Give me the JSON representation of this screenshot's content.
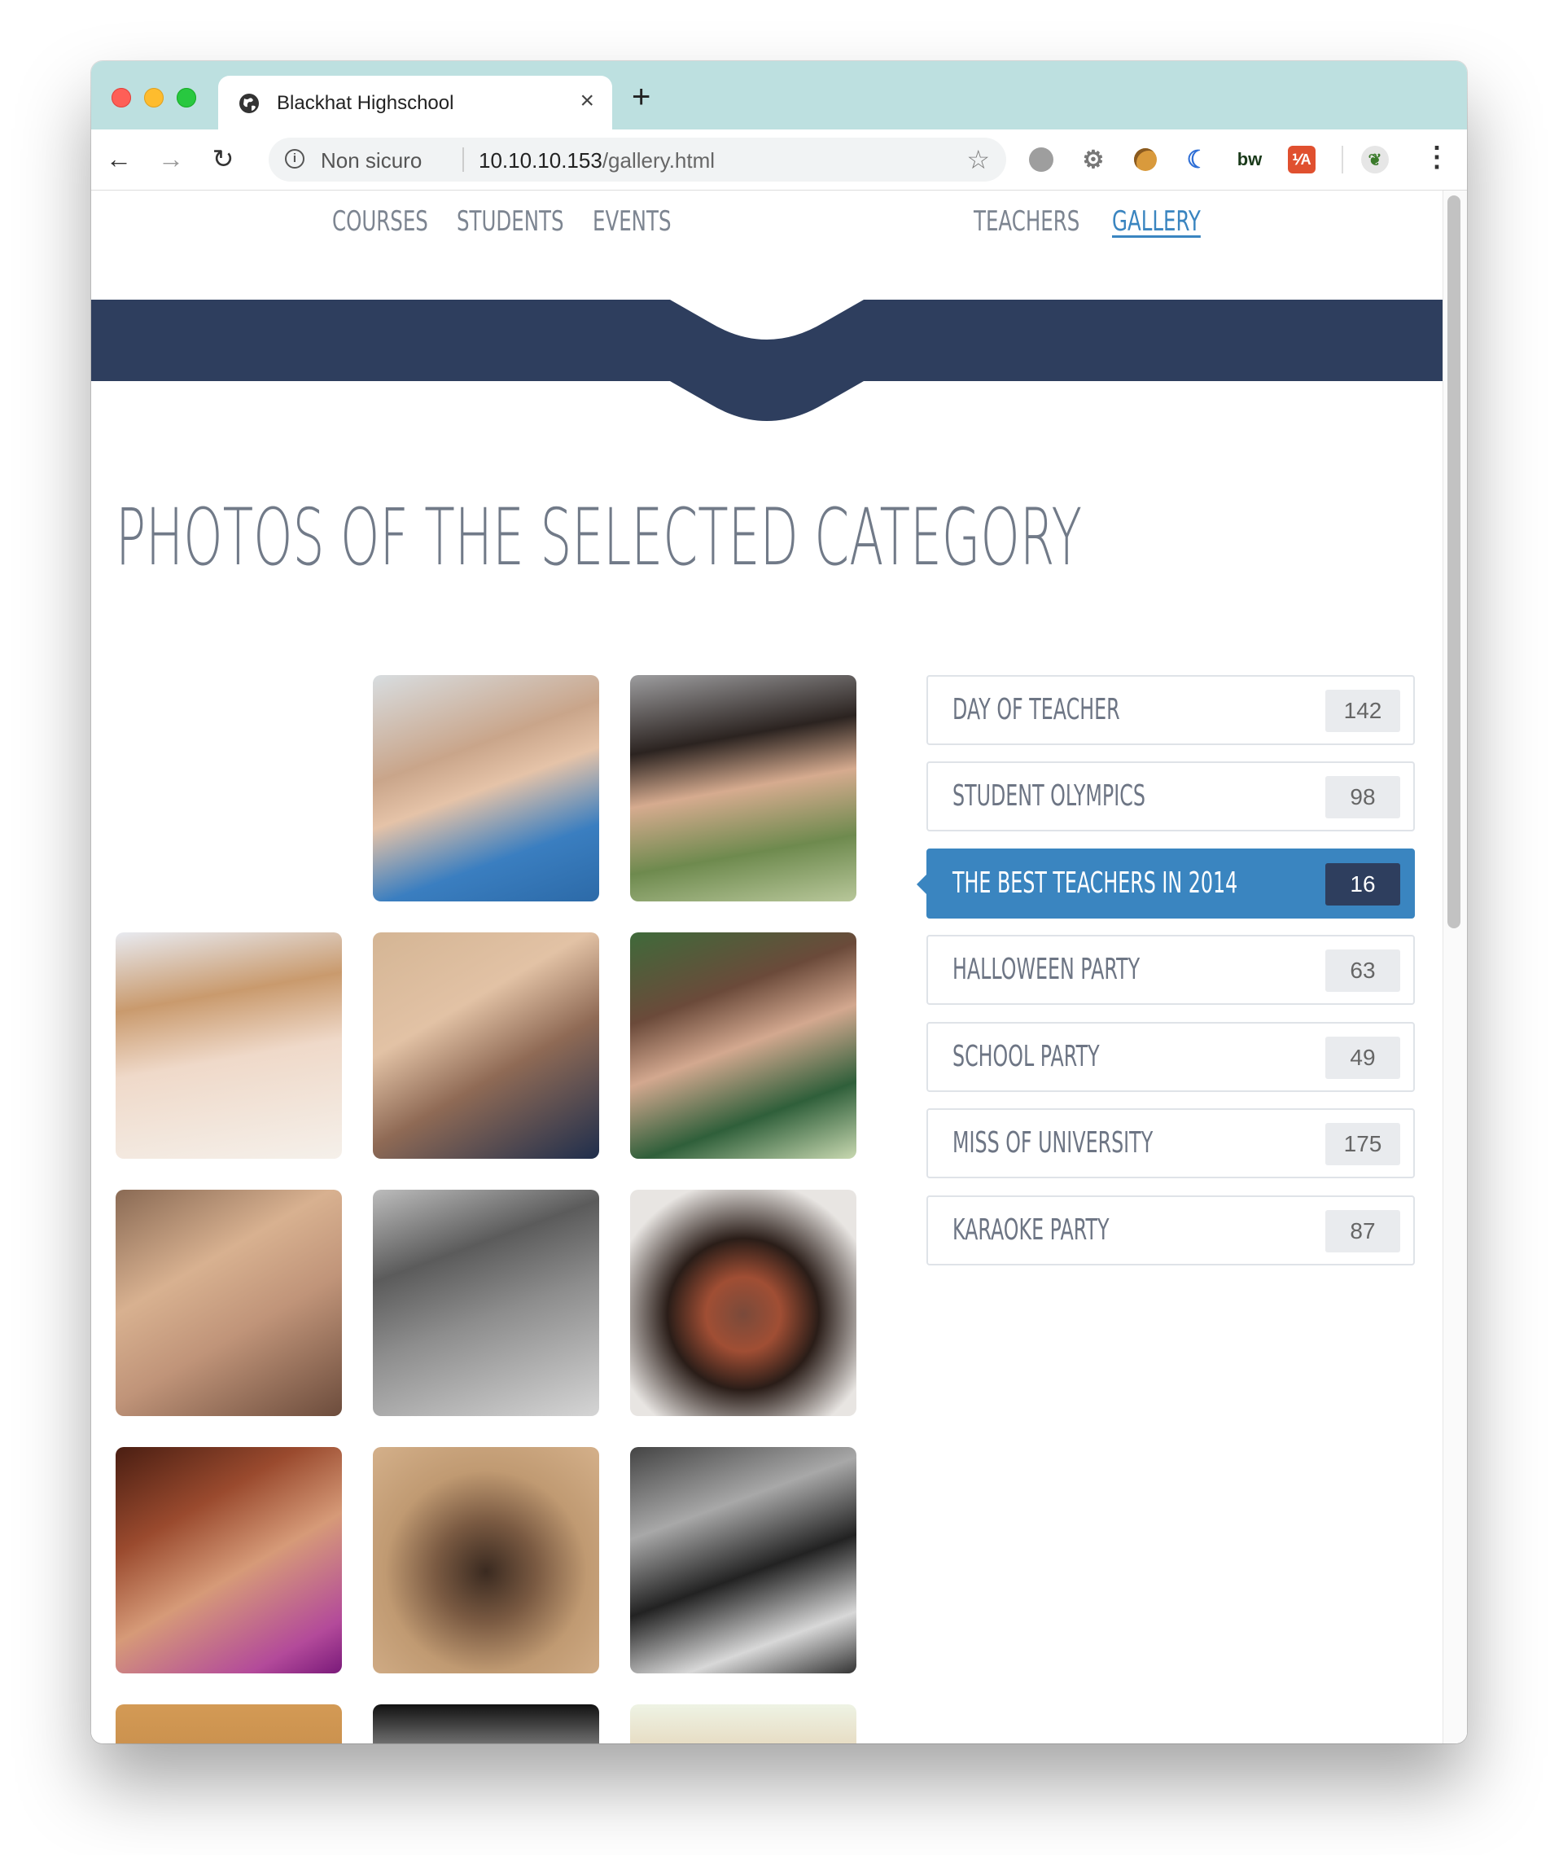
{
  "browser": {
    "tab_title": "Blackhat Highschool",
    "new_tab_label": "+",
    "close_label": "×",
    "address": {
      "security_label": "Non sicuro",
      "host": "10.10.10.153",
      "path": "/gallery.html"
    }
  },
  "site": {
    "nav": {
      "courses": "COURSES",
      "students": "STUDENTS",
      "events": "EVENTS",
      "teachers": "TEACHERS",
      "gallery": "GALLERY"
    },
    "banner_color": "#2e3e5e",
    "page_title": "PHOTOS OF THE SELECTED CATEGORY",
    "categories": [
      {
        "label": "DAY OF TEACHER",
        "count": "142"
      },
      {
        "label": "STUDENT OLYMPICS",
        "count": "98"
      },
      {
        "label": "THE BEST TEACHERS IN 2014",
        "count": "16"
      },
      {
        "label": "HALLOWEEN PARTY",
        "count": "63"
      },
      {
        "label": "SCHOOL PARTY",
        "count": "49"
      },
      {
        "label": "MISS OF UNIVERSITY",
        "count": "175"
      },
      {
        "label": "KARAOKE PARTY",
        "count": "87"
      }
    ],
    "active_category_color": "#3a85c0"
  }
}
